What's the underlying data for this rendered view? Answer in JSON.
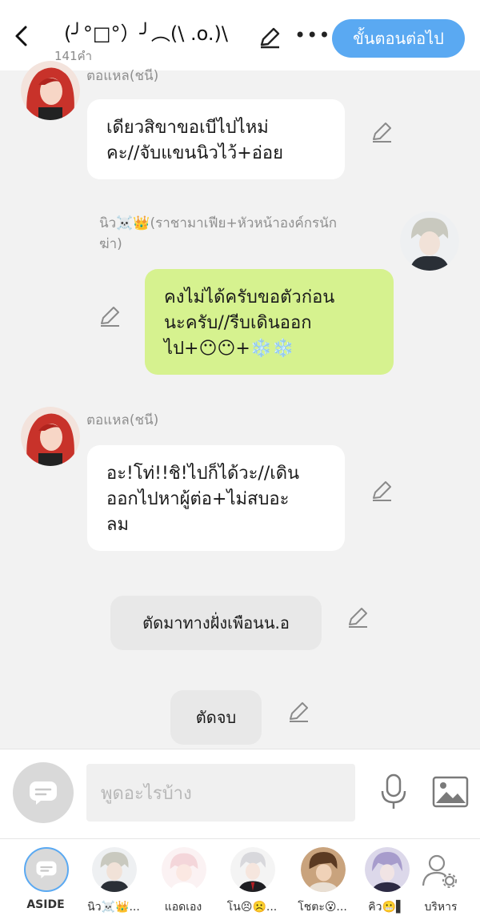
{
  "header": {
    "title": "(╯°□°）╯︵(\\ .o.)\\",
    "word_count": "141คำ",
    "next_button": "ขั้นตอนต่อไป"
  },
  "messages": [
    {
      "name": "ตอแหล(ชนี)",
      "text": "เดียวสิขาขอเบีไปไหม่\nคะ//จับแขนนิวไว้+อ่อย"
    },
    {
      "name": "นิว☠️👑(ราชามาเฟีย+หัวหน้าองค์กรนัก\nฆ่า)",
      "text": "คงไม่ได้ครับขอตัวก่อน\nนะครับ//รีบเดินออก\nไป+😶😶+❄️❄️"
    },
    {
      "name": "ตอแหล(ชนี)",
      "text": "อะ!โท่!!ชิ!ไปก็ได้วะ//เดิน\nออกไปหาผู้ต่อ+ไม่สบอะ\nลม"
    },
    {
      "text": "ตัดมาทางฝั่งเพือนน.อ"
    },
    {
      "text": "ตัดจบ"
    }
  ],
  "composer": {
    "placeholder": "พูดอะไรบ้าง"
  },
  "tabs": [
    {
      "label": "ASIDE"
    },
    {
      "label": "นิว☠️👑..."
    },
    {
      "label": "แอดเอง"
    },
    {
      "label": "โน😣☹️..."
    },
    {
      "label": "โชตะ😮..."
    },
    {
      "label": "คิว😬▌"
    },
    {
      "label": "บริหาร"
    }
  ],
  "colors": {
    "accent": "#5aa9f2",
    "my_bubble": "#d6f28f",
    "other_bubble": "#ffffff",
    "background": "#f2f2f2"
  }
}
